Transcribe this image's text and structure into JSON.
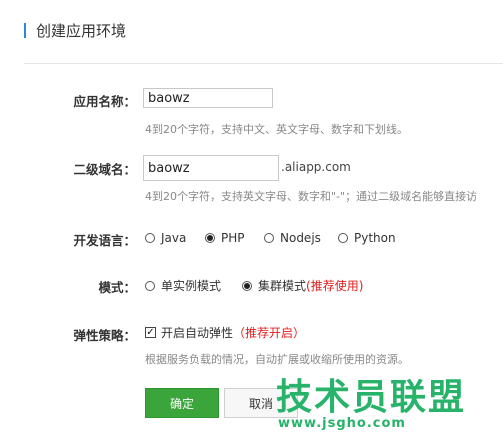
{
  "header": {
    "title": "创建应用环境"
  },
  "form": {
    "app_name": {
      "label": "应用名称：",
      "value": "baowz",
      "hint": "4到20个字符，支持中文、英文字母、数字和下划线。"
    },
    "subdomain": {
      "label": "二级域名：",
      "value": "baowz",
      "suffix": ".aliapp.com",
      "hint": "4到20个字符，支持英文字母、数字和\"-\"；通过二级域名能够直接访"
    },
    "language": {
      "label": "开发语言：",
      "options": [
        "Java",
        "PHP",
        "Nodejs",
        "Python"
      ],
      "selected": "PHP"
    },
    "mode": {
      "label": "模式：",
      "single": "单实例模式",
      "cluster": "集群模式",
      "cluster_note": "(推荐使用)",
      "selected": "cluster"
    },
    "elastic": {
      "label": "弹性策略：",
      "checkbox_label": "开启自动弹性",
      "checkbox_note": "（推荐开启）",
      "checked": true,
      "hint": "根据服务负载的情况，自动扩展或收缩所使用的资源。"
    }
  },
  "buttons": {
    "confirm": "确定",
    "cancel": "取消"
  },
  "watermark": {
    "title": "技术员联盟",
    "url": "www.jsgho.com"
  }
}
